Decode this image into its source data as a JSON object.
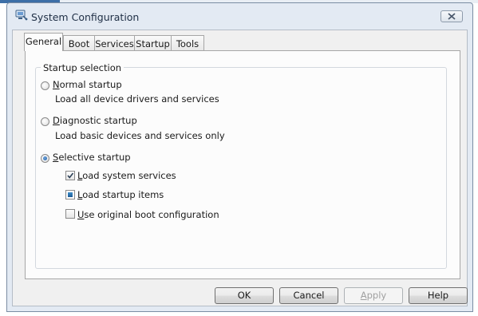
{
  "window": {
    "title": "System Configuration",
    "icon": "msconfig-icon",
    "close_icon": "close-icon"
  },
  "tabs": [
    {
      "label": "General",
      "active": true
    },
    {
      "label": "Boot",
      "active": false
    },
    {
      "label": "Services",
      "active": false
    },
    {
      "label": "Startup",
      "active": false
    },
    {
      "label": "Tools",
      "active": false
    }
  ],
  "startup_selection": {
    "legend": "Startup selection",
    "options": [
      {
        "label": "Normal startup",
        "mnemonic": "N",
        "rest": "ormal startup",
        "description": "Load all device drivers and services",
        "selected": false
      },
      {
        "label": "Diagnostic startup",
        "mnemonic": "D",
        "rest": "iagnostic startup",
        "description": "Load basic devices and services only",
        "selected": false
      },
      {
        "label": "Selective startup",
        "mnemonic": "S",
        "rest": "elective startup",
        "selected": true
      }
    ],
    "selective_items": [
      {
        "label": "Load system services",
        "mnemonic": "L",
        "rest": "oad system services",
        "state": "checked"
      },
      {
        "label": "Load startup items",
        "mnemonic": "L",
        "rest": "oad startup items",
        "state": "indeterminate"
      },
      {
        "label": "Use original boot configuration",
        "mnemonic": "U",
        "rest": "se original boot configuration",
        "state": "unchecked"
      }
    ]
  },
  "buttons": {
    "ok": "OK",
    "cancel": "Cancel",
    "apply": {
      "label": "Apply",
      "mnemonic": "A",
      "rest": "pply",
      "enabled": false
    },
    "help": "Help"
  }
}
